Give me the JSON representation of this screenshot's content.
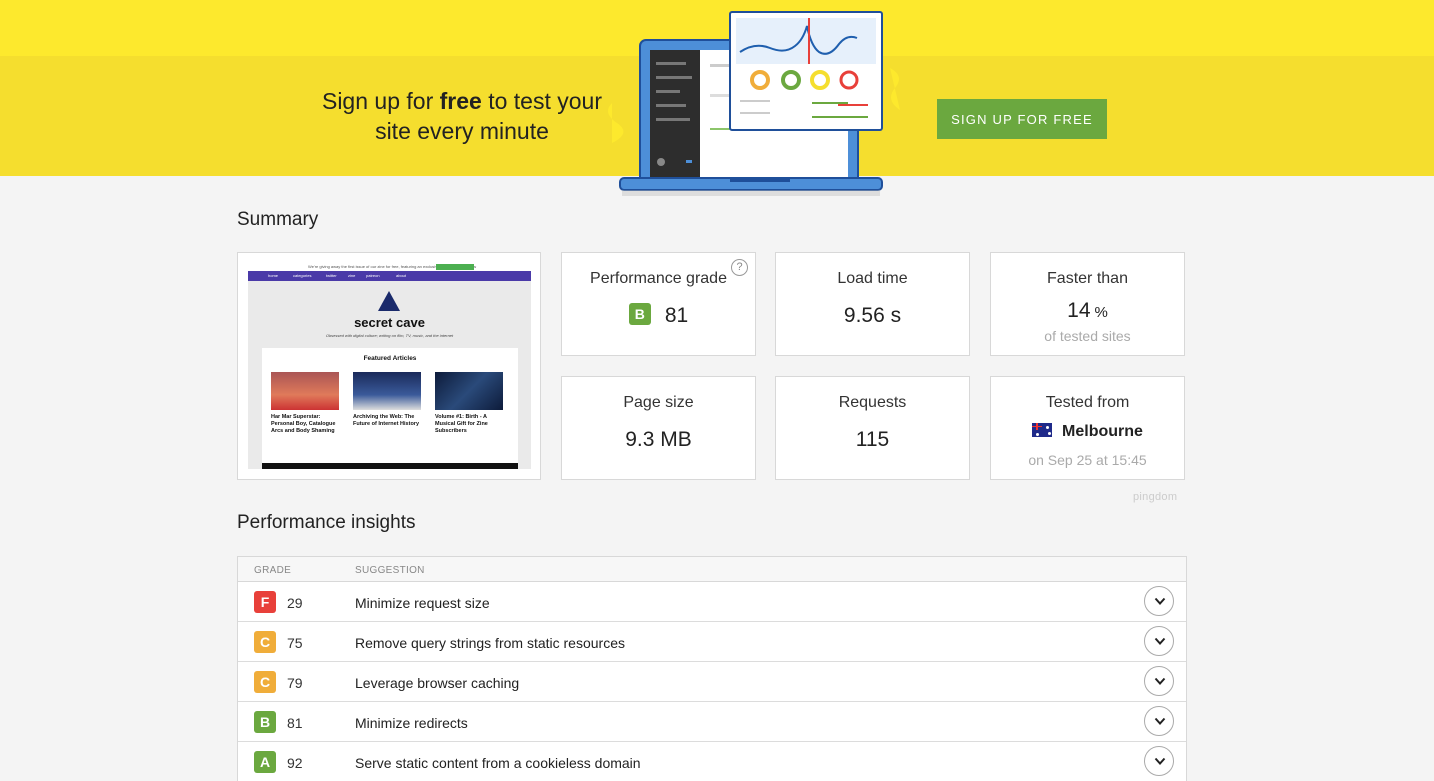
{
  "banner": {
    "headline_pre": "Sign up for ",
    "headline_bold": "free",
    "headline_post": " to test your site every minute",
    "cta_label": "SIGN UP FOR FREE",
    "colors": {
      "background": "#f5de2e",
      "cta": "#6ba83f"
    }
  },
  "summary": {
    "title": "Summary",
    "screenshot": {
      "promo_text": "We're giving away the first issue of our zine for free, featuring an exclusive Vo Sanger interview",
      "promo_button": "Click to get the zine",
      "nav_items": [
        "home",
        "categories",
        "twitter",
        "zine",
        "patreon",
        "about"
      ],
      "site_name": "secret cave",
      "site_tagline": "Obsessed with digital culture; writing on film, TV, music, and the internet",
      "featured_heading": "Featured Articles",
      "articles": [
        {
          "title": "Har Mar Superstar: Personal Boy, Catalogue Arcs and Body Shaming"
        },
        {
          "title": "Archiving the Web: The Future of Internet History"
        },
        {
          "title": "Volume #1: Birth - A Musical Gift for Zine Subscribers"
        }
      ]
    },
    "cards": {
      "performance": {
        "label": "Performance grade",
        "grade": "B",
        "score": "81",
        "help_icon": "question-circle-icon"
      },
      "load_time": {
        "label": "Load time",
        "value": "9.56 s"
      },
      "faster_than": {
        "label": "Faster than",
        "value": "14",
        "unit": "%",
        "sub": "of tested sites"
      },
      "page_size": {
        "label": "Page size",
        "value": "9.3 MB"
      },
      "requests": {
        "label": "Requests",
        "value": "115"
      },
      "tested_from": {
        "label": "Tested from",
        "location": "Melbourne",
        "flag_icon": "australia-flag-icon",
        "sub": "on Sep 25 at 15:45"
      }
    },
    "watermark": "pingdom"
  },
  "insights": {
    "title": "Performance insights",
    "columns": {
      "grade": "GRADE",
      "suggestion": "SUGGESTION"
    },
    "grade_colors": {
      "A": "#6ba83f",
      "B": "#6ba83f",
      "C": "#f0ad3a",
      "F": "#e8403a"
    },
    "rows": [
      {
        "grade": "F",
        "score": "29",
        "suggestion": "Minimize request size"
      },
      {
        "grade": "C",
        "score": "75",
        "suggestion": "Remove query strings from static resources"
      },
      {
        "grade": "C",
        "score": "79",
        "suggestion": "Leverage browser caching"
      },
      {
        "grade": "B",
        "score": "81",
        "suggestion": "Minimize redirects"
      },
      {
        "grade": "A",
        "score": "92",
        "suggestion": "Serve static content from a cookieless domain"
      }
    ]
  }
}
